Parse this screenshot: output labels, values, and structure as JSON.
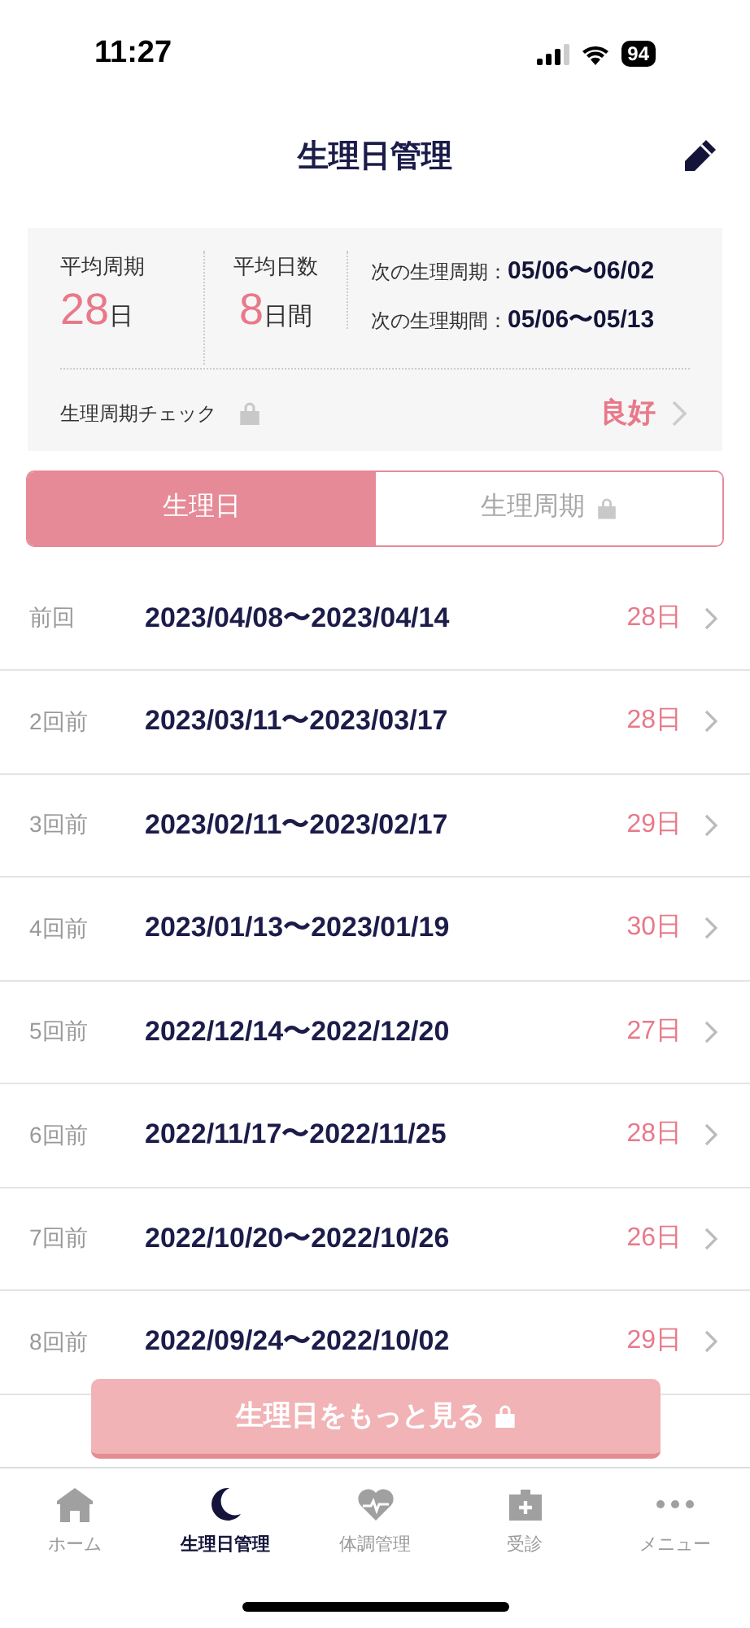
{
  "status_bar": {
    "time": "11:27",
    "battery": "94"
  },
  "header": {
    "title": "生理日管理"
  },
  "summary": {
    "stats": [
      {
        "label": "平均周期",
        "value": "28",
        "unit": "日"
      },
      {
        "label": "平均日数",
        "value": "8",
        "unit": "日間"
      }
    ],
    "next": [
      {
        "label": "次の生理周期：",
        "value": "05/06〜06/02"
      },
      {
        "label": "次の生理期間：",
        "value": "05/06〜05/13"
      }
    ],
    "check": {
      "label": "生理周期チェック",
      "locked": true,
      "result": "良好"
    }
  },
  "tabs": [
    {
      "label": "生理日",
      "selected": true,
      "locked": false
    },
    {
      "label": "生理周期",
      "selected": false,
      "locked": true
    }
  ],
  "rows": [
    {
      "ago": "前回",
      "range": "2023/04/08〜2023/04/14",
      "days": "28日"
    },
    {
      "ago": "2回前",
      "range": "2023/03/11〜2023/03/17",
      "days": "28日"
    },
    {
      "ago": "3回前",
      "range": "2023/02/11〜2023/02/17",
      "days": "29日"
    },
    {
      "ago": "4回前",
      "range": "2023/01/13〜2023/01/19",
      "days": "30日"
    },
    {
      "ago": "5回前",
      "range": "2022/12/14〜2022/12/20",
      "days": "27日"
    },
    {
      "ago": "6回前",
      "range": "2022/11/17〜2022/11/25",
      "days": "28日"
    },
    {
      "ago": "7回前",
      "range": "2022/10/20〜2022/10/26",
      "days": "26日"
    },
    {
      "ago": "8回前",
      "range": "2022/09/24〜2022/10/02",
      "days": "29日"
    }
  ],
  "more_button": {
    "label": "生理日をもっと見る",
    "locked": true
  },
  "nav": [
    {
      "label": "ホーム",
      "kind": "home",
      "selected": false
    },
    {
      "label": "生理日管理",
      "kind": "moon",
      "selected": true
    },
    {
      "label": "体調管理",
      "kind": "heart",
      "selected": false
    },
    {
      "label": "受診",
      "kind": "clinic",
      "selected": false
    },
    {
      "label": "メニュー",
      "kind": "more",
      "selected": false
    }
  ]
}
